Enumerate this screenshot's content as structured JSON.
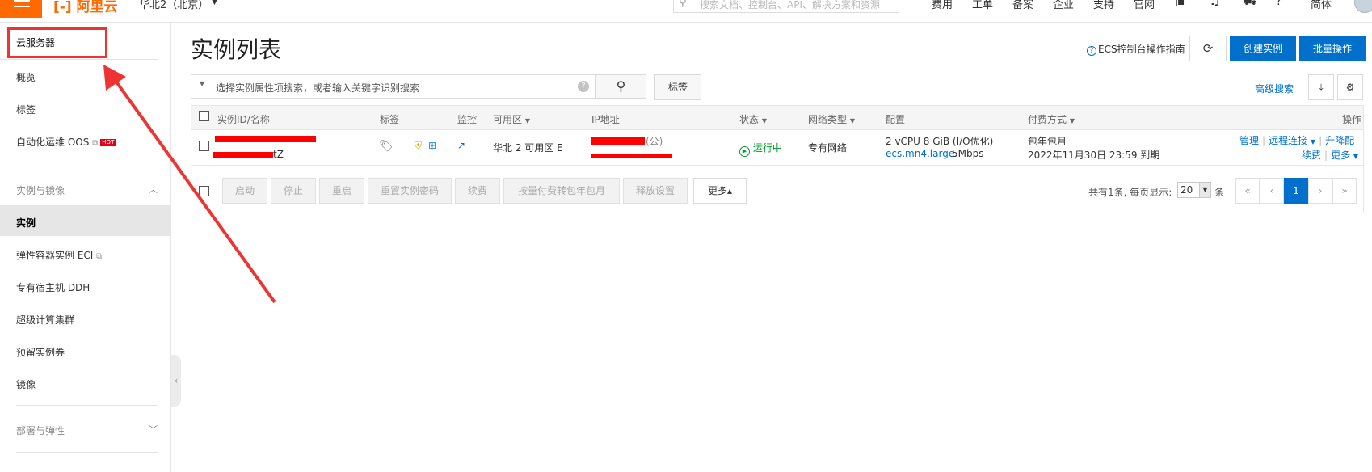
{
  "topbar": {
    "logo": "[-] 阿里云",
    "region": "华北2（北京）",
    "search_placeholder": "搜索文档、控制台、API、解决方案和资源",
    "nav": [
      "费用",
      "工单",
      "备案",
      "企业",
      "支持",
      "官网"
    ],
    "lang": "简体"
  },
  "sidebar": {
    "title": "云服务器",
    "items": [
      {
        "label": "概览"
      },
      {
        "label": "标签"
      },
      {
        "label": "自动化运维 OOS",
        "hot": "HOT"
      }
    ],
    "group_instances": {
      "label": "实例与镜像",
      "items": [
        {
          "label": "实例"
        },
        {
          "label": "弹性容器实例 ECI"
        },
        {
          "label": "专有宿主机 DDH"
        },
        {
          "label": "超级计算集群"
        },
        {
          "label": "预留实例券"
        },
        {
          "label": "镜像"
        }
      ]
    },
    "group_deploy": {
      "label": "部署与弹性"
    }
  },
  "main": {
    "title": "实例列表",
    "guide_link": "ECS控制台操作指南",
    "create_button": "创建实例",
    "batch_button": "批量操作",
    "search_placeholder": "选择实例属性项搜索，或者输入关键字识别搜索",
    "tag_button": "标签",
    "advanced_search": "高级搜索"
  },
  "table": {
    "columns": [
      "实例ID/名称",
      "标签",
      "监控",
      "可用区",
      "IP地址",
      "状态",
      "网络类型",
      "配置",
      "付费方式",
      "操作"
    ],
    "rows": [
      {
        "name_suffix": "tZ",
        "zone": "华北 2 可用区 E",
        "ip_public_suffix": "(公)",
        "status": "运行中",
        "network": "专有网络",
        "config_line1": "2 vCPU 8 GiB (I/O优化)",
        "config_type": "ecs.mn4.large",
        "config_bandwidth": "5Mbps",
        "billing": "包年包月",
        "expire": "2022年11月30日 23:59 到期",
        "actions": {
          "manage": "管理",
          "remote": "远程连接",
          "upgrade": "升降配",
          "renew": "续费",
          "more": "更多"
        }
      }
    ]
  },
  "toolbar": {
    "buttons": [
      "启动",
      "停止",
      "重启",
      "重置实例密码",
      "续费",
      "按量付费转包年包月",
      "释放设置"
    ],
    "more": "更多▴",
    "page_info": "共有1条, 每页显示:",
    "page_size": "20",
    "page_unit": "条",
    "pages": [
      "«",
      "‹",
      "1",
      "›",
      "»"
    ]
  },
  "colors": {
    "accent": "#0070cc",
    "brand": "#ff6a00",
    "annotation": "#ee3433",
    "running": "#009a29"
  }
}
